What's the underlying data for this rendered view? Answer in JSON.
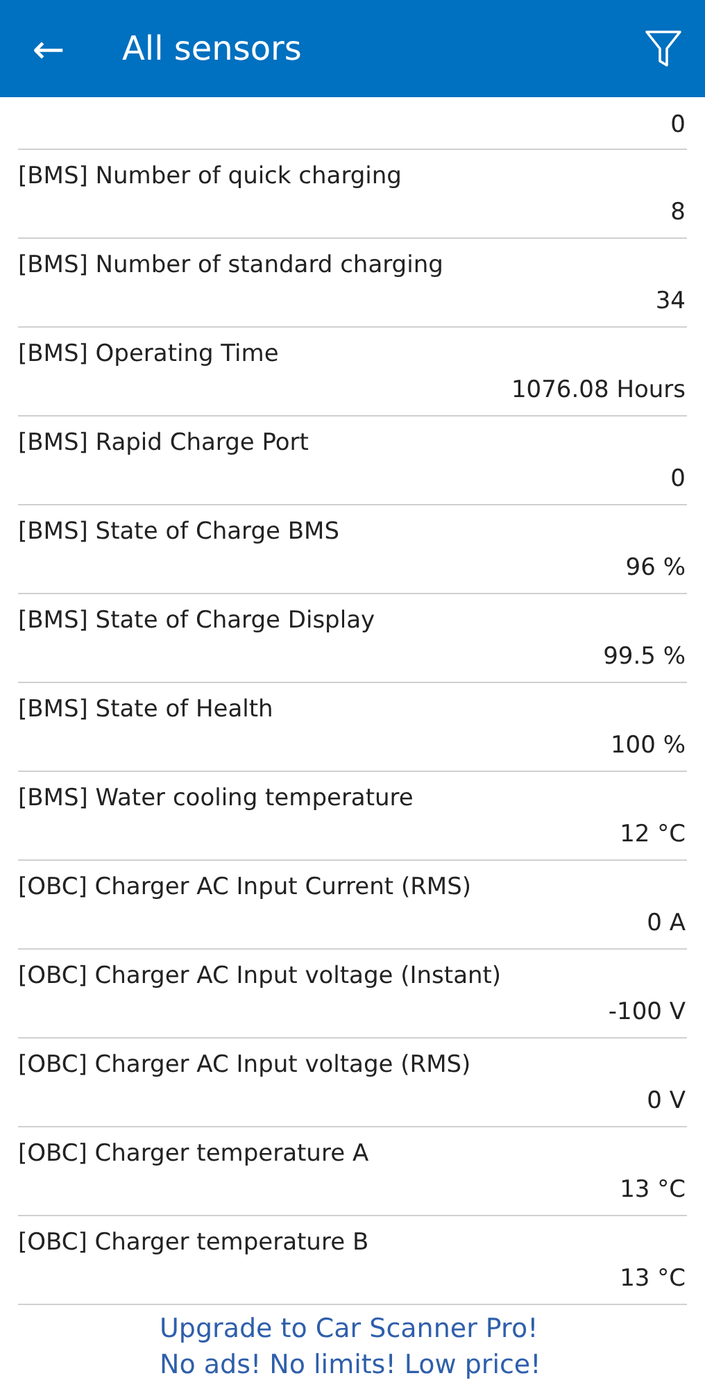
{
  "app_bar": {
    "back_icon": "←",
    "title": "All sensors"
  },
  "sensors": [
    {
      "value": "0"
    },
    {
      "name": "[BMS] Number of quick charging",
      "value": "8"
    },
    {
      "name": "[BMS] Number of standard charging",
      "value": "34"
    },
    {
      "name": "[BMS] Operating Time",
      "value": "1076.08 Hours"
    },
    {
      "name": "[BMS] Rapid Charge Port",
      "value": "0"
    },
    {
      "name": "[BMS] State of Charge BMS",
      "value": "96 %"
    },
    {
      "name": "[BMS] State of Charge Display",
      "value": "99.5 %"
    },
    {
      "name": "[BMS] State of Health",
      "value": "100 %"
    },
    {
      "name": "[BMS] Water cooling temperature",
      "value": "12 °C"
    },
    {
      "name": "[OBC] Charger AC Input Current (RMS)",
      "value": "0 A"
    },
    {
      "name": "[OBC] Charger AC Input voltage (Instant)",
      "value": "-100 V"
    },
    {
      "name": "[OBC] Charger AC Input voltage (RMS)",
      "value": "0 V"
    },
    {
      "name": "[OBC] Charger temperature A",
      "value": "13 °C"
    },
    {
      "name": "[OBC] Charger temperature B",
      "value": "13 °C"
    }
  ],
  "banner": {
    "line_1": "Upgrade to Car Scanner Pro!",
    "line_2": "No ads! No limits! Low price!"
  }
}
